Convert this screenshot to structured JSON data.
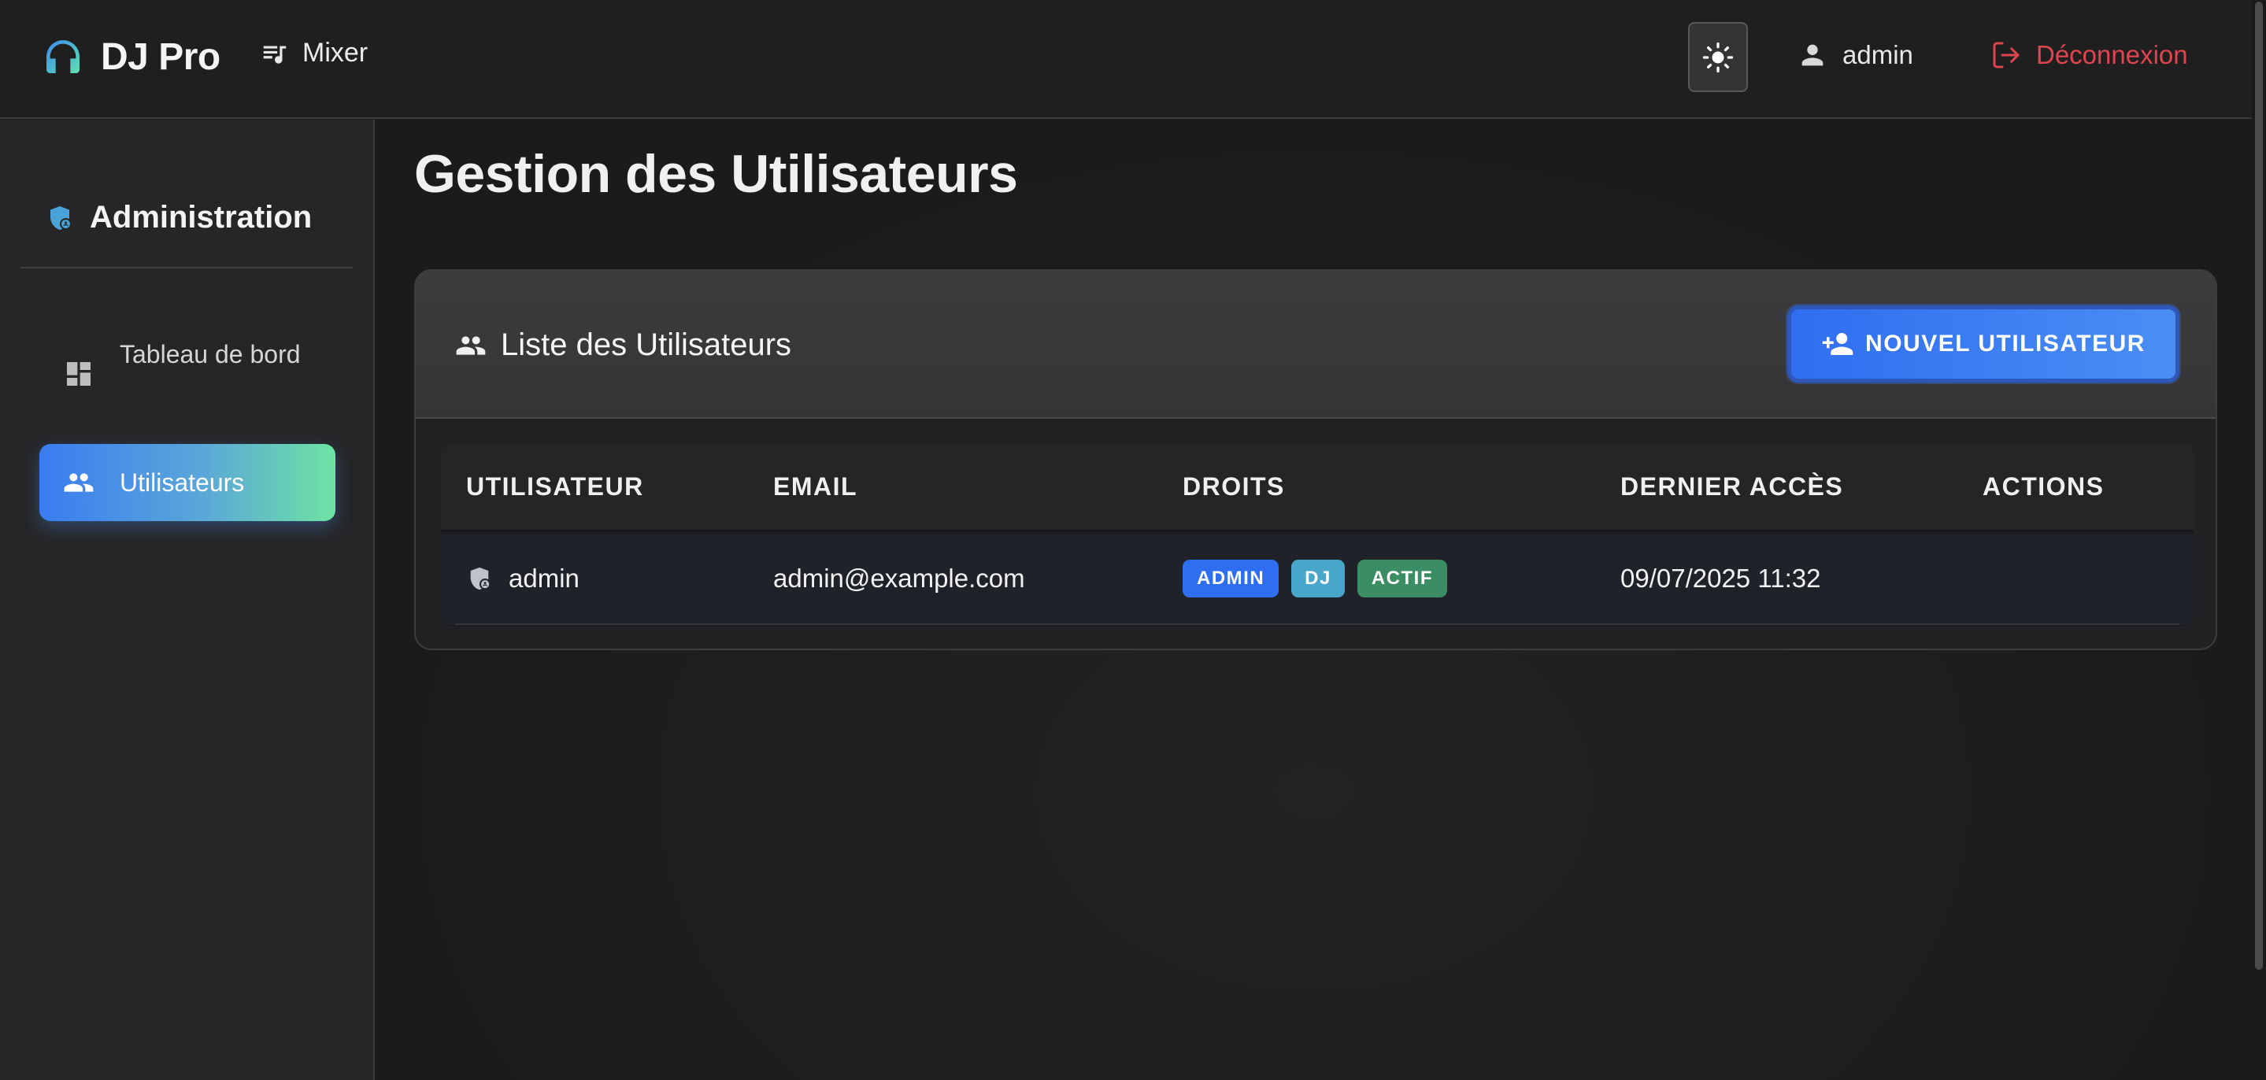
{
  "navbar": {
    "brand": "DJ Pro",
    "mixer_label": "Mixer",
    "user_label": "admin",
    "logout_label": "Déconnexion"
  },
  "sidebar": {
    "title": "Administration",
    "items": [
      {
        "label": "Tableau de bord",
        "icon": "dashboard-icon",
        "active": false
      },
      {
        "label": "Utilisateurs",
        "icon": "users-icon",
        "active": true
      }
    ]
  },
  "main": {
    "page_title": "Gestion des Utilisateurs",
    "card": {
      "title": "Liste des Utilisateurs",
      "new_user_button": "NOUVEL UTILISATEUR",
      "table": {
        "columns": [
          "UTILISATEUR",
          "EMAIL",
          "DROITS",
          "DERNIER ACCÈS",
          "ACTIONS"
        ],
        "rows": [
          {
            "username": "admin",
            "email": "admin@example.com",
            "badges": [
              "ADMIN",
              "DJ",
              "ACTIF"
            ],
            "last_access": "09/07/2025 11:32",
            "actions": ""
          }
        ]
      }
    }
  },
  "colors": {
    "accent_blue": "#2f6ef0",
    "logout_red": "#e0444f",
    "badge_admin": "#2f6ef0",
    "badge_dj": "#47a6c9",
    "badge_actif": "#3b8d64",
    "brand_icon_gradient": [
      "#3b8cf0",
      "#5fe0b0"
    ]
  }
}
